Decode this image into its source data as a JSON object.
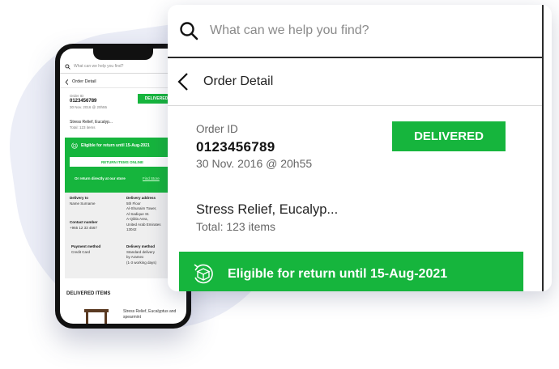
{
  "search": {
    "placeholder": "What can we help you find?"
  },
  "header": {
    "title": "Order Detail"
  },
  "order": {
    "id_label": "Order ID",
    "id": "0123456789",
    "date_short": "30 Nov. 2016 @ 20h55",
    "date": "30 Nov. 2016 @ 20h55",
    "status": "DELIVERED"
  },
  "product": {
    "name": "Stress Relief, Eucalyp...",
    "total": "Total: 123 items"
  },
  "returns": {
    "eligible": "Eligible for return until 15-Aug-2021",
    "online_button": "RETURN ITEMS ONLINE",
    "store_text": "Or return directly at our store",
    "store_link": "Find Store"
  },
  "delivery": {
    "to_label": "Delivery to",
    "to_name": "Name Surname",
    "contact_label": "Contact number",
    "contact_value": "+965 12 33 4567",
    "payment_label": "Payment method",
    "payment_value": "Credit Card",
    "address_label": "Delivery address",
    "address_lines": [
      "5th Floor",
      "Al-Shunaim Tower,",
      "Al Sadique St.",
      "A-Qibla Area,",
      "United Arab Emirates",
      "13042"
    ],
    "method_label": "Delivery method",
    "method_lines": [
      "Standard delivery",
      "by Aramex",
      "(1-3 working days)"
    ]
  },
  "items": {
    "heading": "DELIVERED ITEMS",
    "first_item": "Stress Relief, Eucalyptus and spearmint"
  },
  "colors": {
    "accent": "#16b53d",
    "background_blob": "#eceef7"
  }
}
